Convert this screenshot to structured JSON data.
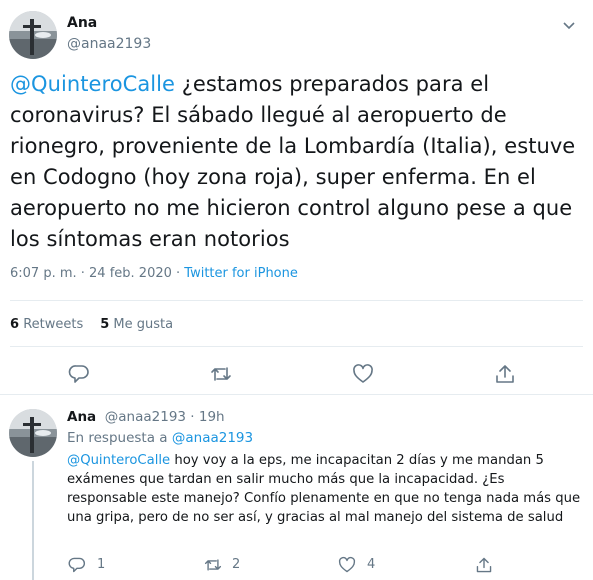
{
  "main_tweet": {
    "author_name": "Ana",
    "author_handle": "@anaa2193",
    "mention": "@QuinteroCalle",
    "text": " ¿estamos preparados para el coronavirus? El sábado llegué al aeropuerto de rionegro, proveniente de la Lombardía (Italia), estuve en Codogno (hoy zona roja), super enferma. En el aeropuerto no me hicieron control alguno pese a que los síntomas eran notorios",
    "timestamp": "6:07 p. m. · 24 feb. 2020 · ",
    "source": "Twitter for iPhone",
    "retweets_count": "6",
    "retweets_label": "Retweets",
    "likes_count": "5",
    "likes_label": "Me gusta"
  },
  "reply_tweet": {
    "author_name": "Ana",
    "author_handle": "@anaa2193",
    "time_ago": "· 19h",
    "reply_prefix": "En respuesta a ",
    "reply_mention": "@anaa2193",
    "mention": "@QuinteroCalle",
    "text": " hoy voy a la eps, me incapacitan 2 días y me mandan 5 exámenes que tardan en salir mucho más que la incapacidad. ¿Es responsable este manejo? Confío plenamente en que no tenga nada más que una gripa, pero de no ser así, y gracias al mal manejo del sistema de salud",
    "reply_count": "1",
    "retweet_count": "2",
    "like_count": "4"
  },
  "colors": {
    "link": "#1b95e0",
    "secondary": "#657786",
    "text": "#14171a",
    "border": "#e6ecf0"
  },
  "icons": {
    "reply": "reply-icon",
    "retweet": "retweet-icon",
    "like": "heart-icon",
    "share": "share-icon",
    "more": "chevron-down-icon"
  }
}
